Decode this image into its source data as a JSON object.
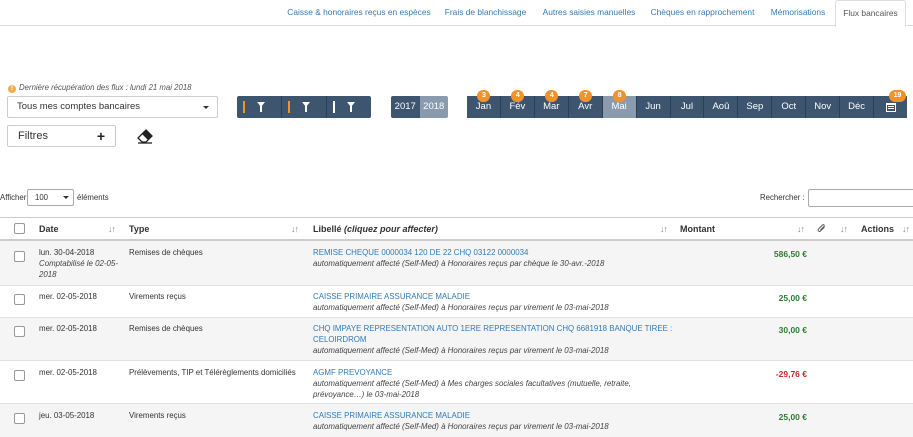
{
  "tabs": [
    {
      "label": "Caisse & honoraires reçus en espèces",
      "active": false
    },
    {
      "label": "Frais de blanchissage",
      "active": false
    },
    {
      "label": "Autres saisies manuelles",
      "active": false
    },
    {
      "label": "Chèques en rapprochement",
      "active": false
    },
    {
      "label": "Mémorisations",
      "active": false
    },
    {
      "label": "Flux bancaires",
      "active": true
    }
  ],
  "last_fetch": "Dernière récupération des flux : lundi 21 mai 2018",
  "account_select": {
    "value": "Tous mes comptes bancaires"
  },
  "filter_colors": [
    "#f0932b",
    "#f0932b",
    "#ffffff"
  ],
  "years": [
    {
      "label": "2017",
      "active": false
    },
    {
      "label": "2018",
      "active": true
    }
  ],
  "months": [
    {
      "label": "Jan",
      "badge": "3",
      "active": false
    },
    {
      "label": "Fév",
      "badge": "4",
      "active": false
    },
    {
      "label": "Mar",
      "badge": "4",
      "active": false
    },
    {
      "label": "Avr",
      "badge": "7",
      "active": false
    },
    {
      "label": "Mai",
      "badge": "8",
      "active": true
    },
    {
      "label": "Jun",
      "badge": "",
      "active": false
    },
    {
      "label": "Jul",
      "badge": "",
      "active": false
    },
    {
      "label": "Aoû",
      "badge": "",
      "active": false
    },
    {
      "label": "Sep",
      "badge": "",
      "active": false
    },
    {
      "label": "Oct",
      "badge": "",
      "active": false
    },
    {
      "label": "Nov",
      "badge": "",
      "active": false
    },
    {
      "label": "Déc",
      "badge": "",
      "active": false
    }
  ],
  "calendar_badge": "19",
  "filters_label": "Filtres",
  "length": {
    "prefix": "Afficher",
    "value": "100",
    "suffix": "éléments"
  },
  "search_label": "Rechercher :",
  "table": {
    "headers": {
      "date": "Date",
      "type": "Type",
      "libelle": "Libellé",
      "libelle_hint": "(cliquez pour affecter)",
      "montant": "Montant",
      "actions": "Actions"
    },
    "rows": [
      {
        "date": "lun. 30-04-2018",
        "date_sub": "Comptabilisé le 02-05-2018",
        "type": "Remises de chèques",
        "libelle": "REMISE CHEQUE 0000034 120 DE 22 CHQ 03122 0000034",
        "libelle_sub": "automatiquement affecté (Self-Med) à Honoraires reçus par chèque le 30-avr.-2018",
        "montant": "586,50 €",
        "sign": "pos"
      },
      {
        "date": "mer. 02-05-2018",
        "date_sub": "",
        "type": "Virements reçus",
        "libelle": "CAISSE PRIMAIRE ASSURANCE MALADIE",
        "libelle_sub": "automatiquement affecté (Self-Med) à Honoraires reçus par virement le 03-mai-2018",
        "montant": "25,00 €",
        "sign": "pos"
      },
      {
        "date": "mer. 02-05-2018",
        "date_sub": "",
        "type": "Remises de chèques",
        "libelle": "CHQ IMPAYE REPRESENTATION AUTO 1ERE REPRESENTATION CHQ 6681918 BANQUE TIREE : CELOIRDROM",
        "libelle_sub": "automatiquement affecté (Self-Med) à Honoraires reçus par virement le 03-mai-2018",
        "montant": "30,00 €",
        "sign": "pos"
      },
      {
        "date": "mer. 02-05-2018",
        "date_sub": "",
        "type": "Prélèvements, TIP et Télérèglements domiciliés",
        "libelle": "AGMF PREVOYANCE",
        "libelle_sub": "automatiquement affecté (Self-Med) à Mes charges sociales facultatives (mutuelle, retraite, prévoyance…) le 03-mai-2018",
        "montant": "-29,76 €",
        "sign": "neg"
      },
      {
        "date": "jeu. 03-05-2018",
        "date_sub": "",
        "type": "Virements reçus",
        "libelle": "CAISSE PRIMAIRE ASSURANCE MALADIE",
        "libelle_sub": "automatiquement affecté (Self-Med) à Honoraires reçus par virement le 03-mai-2018",
        "montant": "25,00 €",
        "sign": "pos"
      }
    ]
  }
}
